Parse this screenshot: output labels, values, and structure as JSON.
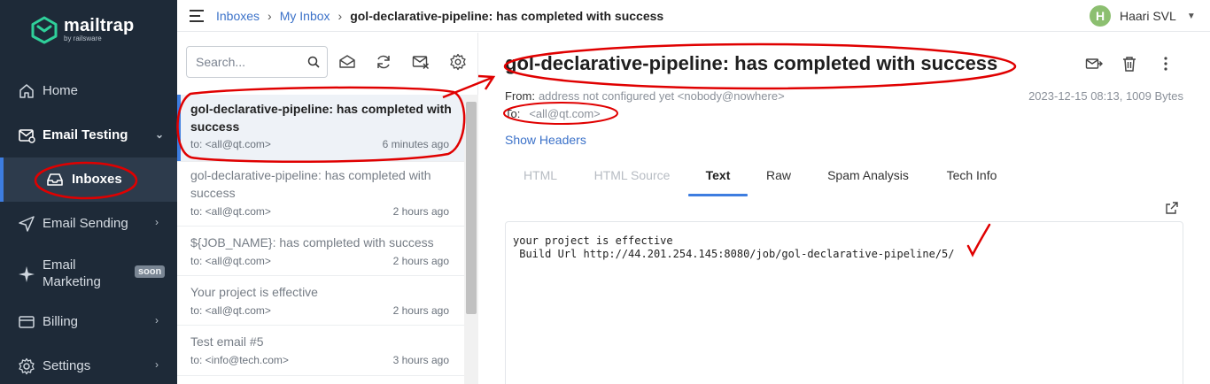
{
  "brand": {
    "name": "mailtrap",
    "sub": "by railsware",
    "accent": "#3d7de0",
    "logo_color": "#2fd09a"
  },
  "sidebar": {
    "items": [
      {
        "label": "Home",
        "icon": "home-icon"
      },
      {
        "label": "Email Testing",
        "icon": "email-testing-icon",
        "expanded": true
      },
      {
        "label": "Inboxes",
        "icon": "inbox-icon",
        "active": true
      },
      {
        "label": "Email Sending",
        "icon": "send-icon"
      },
      {
        "label": "Email Marketing",
        "icon": "sparkle-icon",
        "badge": "soon"
      },
      {
        "label": "Billing",
        "icon": "billing-icon"
      },
      {
        "label": "Settings",
        "icon": "gear-icon"
      }
    ]
  },
  "topbar": {
    "breadcrumb": [
      "Inboxes",
      "My Inbox",
      "gol-declarative-pipeline: has completed with success"
    ],
    "user": {
      "initial": "H",
      "name": "Haari SVL"
    }
  },
  "messages": {
    "search_placeholder": "Search...",
    "items": [
      {
        "subject": "gol-declarative-pipeline: has completed with success",
        "to": "to: <all@qt.com>",
        "ago": "6 minutes ago",
        "active": true
      },
      {
        "subject": "gol-declarative-pipeline: has completed with success",
        "to": "to: <all@qt.com>",
        "ago": "2 hours ago"
      },
      {
        "subject": "${JOB_NAME}: has completed with success",
        "to": "to: <all@qt.com>",
        "ago": "2 hours ago"
      },
      {
        "subject": "Your project is effective",
        "to": "to: <all@qt.com>",
        "ago": "2 hours ago"
      },
      {
        "subject": "Test email #5",
        "to": "to: <info@tech.com>",
        "ago": "3 hours ago"
      }
    ]
  },
  "detail": {
    "title": "gol-declarative-pipeline: has completed with success",
    "from_label": "From:",
    "from_value": "address not configured yet <nobody@nowhere>",
    "to_label": "To:",
    "to_value": "<all@qt.com>",
    "date_size": "2023-12-15 08:13, 1009 Bytes",
    "show_headers": "Show Headers",
    "tabs": [
      "HTML",
      "HTML Source",
      "Text",
      "Raw",
      "Spam Analysis",
      "Tech Info"
    ],
    "active_tab": "Text",
    "body_lines": [
      "your project is effective",
      " Build Url http://44.201.254.145:8080/job/gol-declarative-pipeline/5/"
    ]
  }
}
